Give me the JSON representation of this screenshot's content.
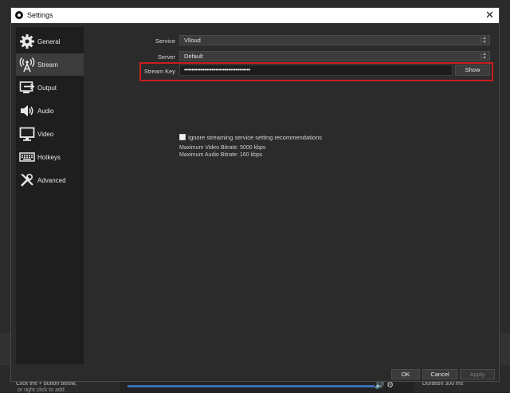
{
  "window": {
    "title": "Settings",
    "close_glyph": "✕"
  },
  "sidebar": {
    "items": [
      {
        "label": "General",
        "icon": "gear-icon"
      },
      {
        "label": "Stream",
        "icon": "broadcast-icon",
        "active": true
      },
      {
        "label": "Output",
        "icon": "output-icon"
      },
      {
        "label": "Audio",
        "icon": "speaker-icon"
      },
      {
        "label": "Video",
        "icon": "monitor-icon"
      },
      {
        "label": "Hotkeys",
        "icon": "keyboard-icon"
      },
      {
        "label": "Advanced",
        "icon": "tools-icon"
      }
    ]
  },
  "stream": {
    "service_label": "Service",
    "service_value": "Vlloud",
    "server_label": "Server",
    "server_value": "Default",
    "key_label": "Stream Key",
    "key_value": "••••••••••••••••••••••••••••••••••••",
    "show_button": "Show",
    "ignore_label": "Ignore streaming service setting recommendations",
    "max_video": "Maximum Video Bitrate: 5000 kbps",
    "max_audio": "Maximum Audio Bitrate: 160 kbps"
  },
  "footer": {
    "ok": "OK",
    "cancel": "Cancel",
    "apply": "Apply"
  },
  "background": {
    "left_text": "Click the + button below,",
    "left_text2": "or right click to add",
    "right_text": "Duration    300 ms"
  },
  "colors": {
    "highlight": "#c81e1e",
    "accent_bar": "#3b6fb6"
  }
}
